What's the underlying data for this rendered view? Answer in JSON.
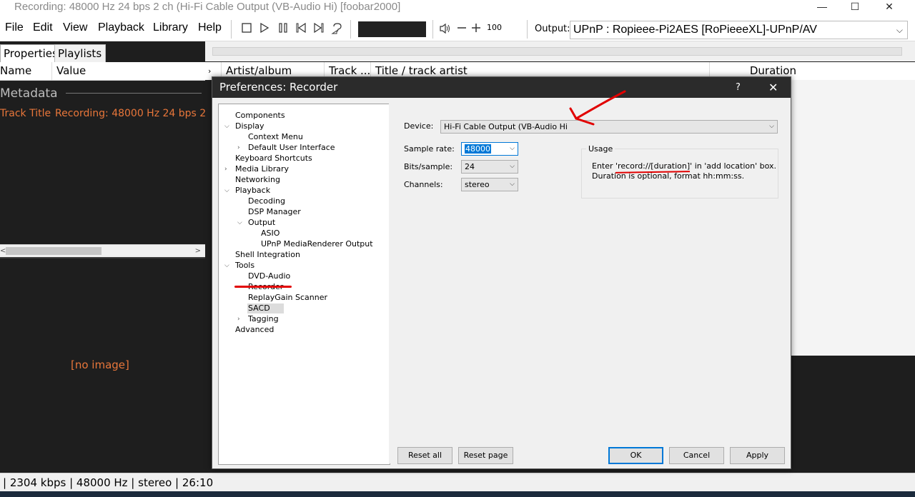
{
  "window": {
    "title": "Recording: 48000 Hz 24 bps 2 ch (Hi-Fi Cable Output (VB-Audio Hi)  [foobar2000]",
    "minimize": "—",
    "maximize": "☐",
    "close": "✕"
  },
  "menu": [
    "File",
    "Edit",
    "View",
    "Playback",
    "Library",
    "Help"
  ],
  "toolbar": {
    "volume_value": "100",
    "output_label": "Output:",
    "output_value": "UPnP : Ropieee-Pi2AES [RoPieeeXL]-UPnP/AV"
  },
  "left_panel": {
    "tabs": [
      "Properties",
      "Playlists"
    ],
    "columns": [
      "Name",
      "Value"
    ],
    "group": "Metadata",
    "row": {
      "name": "Track Title",
      "value": "Recording: 48000 Hz 24 bps 2"
    },
    "no_image": "[no image]"
  },
  "playlist": {
    "columns": [
      "Artist/album",
      "Track ...",
      "Title / track artist",
      "Duration"
    ]
  },
  "status": "| 2304 kbps | 48000 Hz | stereo | 26:10",
  "dialog": {
    "title": "Preferences: Recorder",
    "help": "?",
    "close": "✕",
    "tree": [
      {
        "label": "Components"
      },
      {
        "label": "Display"
      },
      {
        "label": "Context Menu"
      },
      {
        "label": "Default User Interface"
      },
      {
        "label": "Keyboard Shortcuts"
      },
      {
        "label": "Media Library"
      },
      {
        "label": "Networking"
      },
      {
        "label": "Playback"
      },
      {
        "label": "Decoding"
      },
      {
        "label": "DSP Manager"
      },
      {
        "label": "Output"
      },
      {
        "label": "ASIO"
      },
      {
        "label": "UPnP MediaRenderer Output"
      },
      {
        "label": "Shell Integration"
      },
      {
        "label": "Tools"
      },
      {
        "label": "DVD-Audio"
      },
      {
        "label": "Recorder"
      },
      {
        "label": "ReplayGain Scanner"
      },
      {
        "label": "SACD"
      },
      {
        "label": "Tagging"
      },
      {
        "label": "Advanced"
      }
    ],
    "device_label": "Device:",
    "device_value": "Hi-Fi Cable Output (VB-Audio Hi",
    "sample_rate_label": "Sample rate:",
    "sample_rate_value": "48000",
    "bits_label": "Bits/sample:",
    "bits_value": "24",
    "channels_label": "Channels:",
    "channels_value": "stereo",
    "usage_title": "Usage",
    "usage_line1": "Enter 'record://[duration]' in 'add location' box.",
    "usage_line2": "Duration is optional, format hh:mm:ss.",
    "buttons": {
      "reset_all": "Reset all",
      "reset_page": "Reset page",
      "ok": "OK",
      "cancel": "Cancel",
      "apply": "Apply"
    }
  },
  "colors": {
    "accent_orange": "#e8763a",
    "annotation_red": "#e10000",
    "dark_bg": "#1e1e1e"
  }
}
